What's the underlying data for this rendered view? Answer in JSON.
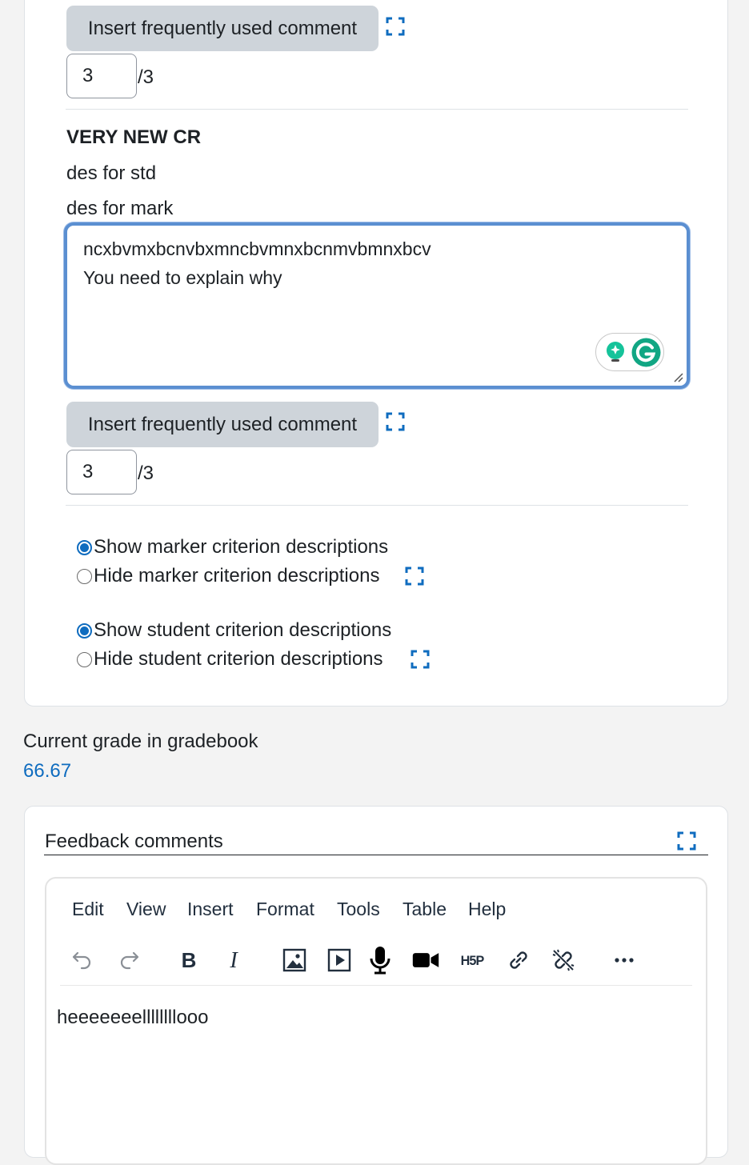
{
  "criteria": [
    {
      "insert_comment_label": "Insert frequently used comment",
      "score": "3",
      "max": "/3"
    },
    {
      "title": "VERY NEW CR",
      "student_description": "des for std",
      "marker_description": "des for mark",
      "remark_lines": [
        "ncxbvmxbcnvbxmncbvmnxbcnmvbmnxbcv",
        "You need to explain why"
      ],
      "insert_comment_label": "Insert frequently used comment",
      "score": "3",
      "max": "/3"
    }
  ],
  "options": {
    "show_marker": {
      "label": "Show marker criterion descriptions",
      "checked": true
    },
    "hide_marker": {
      "label": "Hide marker criterion descriptions",
      "checked": false
    },
    "show_student": {
      "label": "Show student criterion descriptions",
      "checked": true
    },
    "hide_student": {
      "label": "Hide student criterion descriptions",
      "checked": false
    }
  },
  "gradebook": {
    "label": "Current grade in gradebook",
    "value": "66.67"
  },
  "feedback": {
    "title": "Feedback comments",
    "menu": [
      "Edit",
      "View",
      "Insert",
      "Format",
      "Tools",
      "Table",
      "Help"
    ],
    "toolbar_icons": [
      "undo-icon",
      "redo-icon",
      "bold-icon",
      "italic-icon",
      "image-icon",
      "media-icon",
      "microphone-icon",
      "video-camera-icon",
      "h5p-icon",
      "link-icon",
      "unlink-icon",
      "more-icon"
    ],
    "content": "heeeeeeellllllllooo"
  },
  "colors": {
    "accent": "#0f6cbf",
    "button_bg": "#ced4da",
    "focus_border": "#5b8fd1",
    "page_bg": "#f3f3f3"
  }
}
